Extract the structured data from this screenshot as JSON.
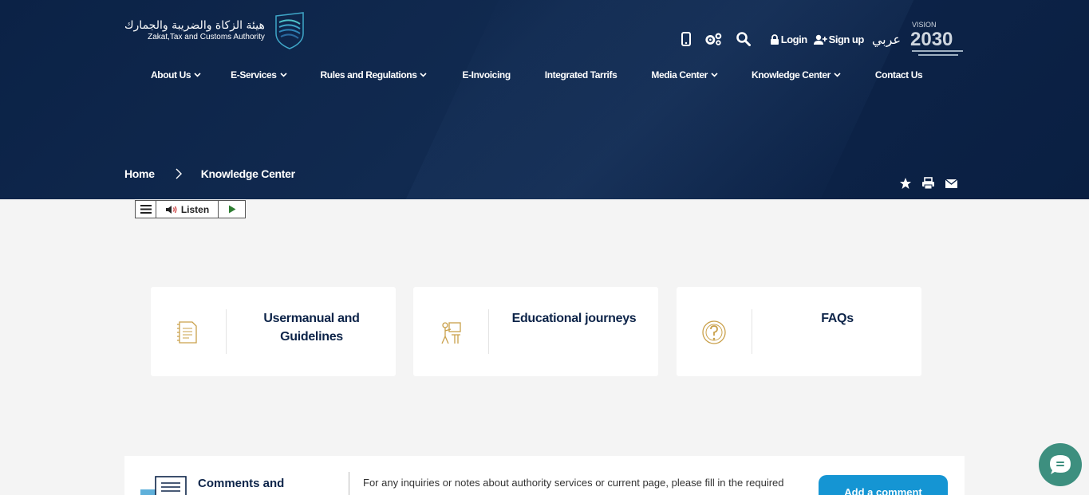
{
  "header": {
    "logo_arabic": "هيئة الزكاة والضريبة والجمارك",
    "logo_english": "Zakat,Tax and Customs Authority",
    "login_label": "Login",
    "signup_label": "Sign up",
    "arabic_label": "عربي",
    "vision_top": "VISION",
    "vision_year": "2030"
  },
  "nav": [
    {
      "label": "About Us",
      "dropdown": true
    },
    {
      "label": "E-Services",
      "dropdown": true
    },
    {
      "label": "Rules and Regulations",
      "dropdown": true
    },
    {
      "label": "E-Invoicing",
      "dropdown": false
    },
    {
      "label": "Integrated Tarrifs",
      "dropdown": false
    },
    {
      "label": "Media Center",
      "dropdown": true
    },
    {
      "label": "Knowledge Center",
      "dropdown": true
    },
    {
      "label": "Contact Us",
      "dropdown": false
    }
  ],
  "breadcrumb": {
    "home": "Home",
    "current": "Knowledge Center"
  },
  "listen": {
    "label": "Listen"
  },
  "cards": [
    {
      "line1": "Usermanual and",
      "line2": "Guidelines",
      "icon": "manual-icon"
    },
    {
      "line1": "Educational journeys",
      "line2": "",
      "icon": "education-icon"
    },
    {
      "line1": "FAQs",
      "line2": "",
      "icon": "faq-icon"
    }
  ],
  "feedback": {
    "title": "Comments and",
    "text": "For any inquiries or notes about authority services or current page, please fill in the required",
    "button": "Add a comment"
  },
  "colors": {
    "navy": "#0d2449",
    "gold": "#c9a04a",
    "accent_blue": "#1595d3",
    "chat_green": "#3d8f7f"
  }
}
